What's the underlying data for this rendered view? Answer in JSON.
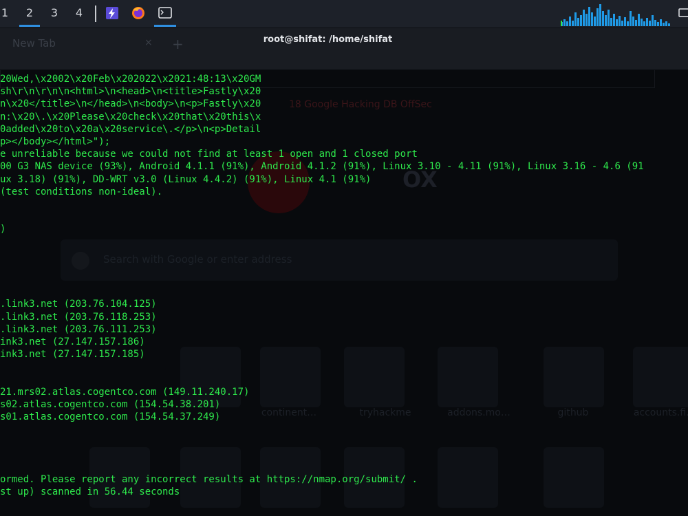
{
  "panel": {
    "workspaces": [
      {
        "label": "1",
        "active": false
      },
      {
        "label": "2",
        "active": true
      },
      {
        "label": "3",
        "active": false
      },
      {
        "label": "4",
        "active": false
      }
    ],
    "apps": [
      "bolt-launcher-icon",
      "firefox-icon",
      "terminal-icon"
    ],
    "accent_color": "#2f8fe0"
  },
  "window": {
    "title": "root@shifat: /home/shifat"
  },
  "terminal": {
    "text_color": "#2ee94c",
    "lines": [
      "20Wed,\\x2002\\x20Feb\\x202022\\x2021:48:13\\x20GM",
      "sh\\r\\n\\r\\n\\n<html>\\n<head>\\n<title>Fastly\\x20",
      "n\\x20</title>\\n</head>\\n<body>\\n<p>Fastly\\x20",
      "n:\\x20\\.\\x20Please\\x20check\\x20that\\x20this\\x",
      "0added\\x20to\\x20a\\x20service\\.</p>\\n<p>Detail",
      "p></body></html>\");",
      "e unreliable because we could not find at least 1 open and 1 closed port",
      "00 G3 NAS device (93%), Android 4.1.1 (91%), Android 4.1.2 (91%), Linux 3.10 - 4.11 (91%), Linux 3.16 - 4.6 (91",
      "ux 3.18) (91%), DD-WRT v3.0 (Linux 4.4.2) (91%), Linux 4.1 (91%)",
      "(test conditions non-ideal).",
      "",
      "",
      ")",
      "",
      "",
      "",
      "",
      "",
      ".link3.net (203.76.104.125)",
      ".link3.net (203.76.118.253)",
      ".link3.net (203.76.111.253)",
      "ink3.net (27.147.157.186)",
      "ink3.net (27.147.157.185)",
      "",
      "",
      "21.mrs02.atlas.cogentco.com (149.11.240.17)",
      "s02.atlas.cogentco.com (154.54.38.201)",
      "s01.atlas.cogentco.com (154.54.37.249)",
      "",
      "",
      "",
      "",
      "ormed. Please report any incorrect results at https://nmap.org/submit/ .",
      "st up) scanned in 56.44 seconds"
    ]
  },
  "background_ghost": {
    "tab_label": "New Tab",
    "tab_close": "×",
    "new_tab_symbol": "+",
    "bookmarks": "18   Google Hacking DB   OffSec",
    "logo_text": "OX",
    "search_placeholder": "Search with Google or enter address",
    "tiles": [
      "continent…",
      "tryhackme",
      "addons.mo…",
      "github",
      "accounts.fi…"
    ]
  }
}
